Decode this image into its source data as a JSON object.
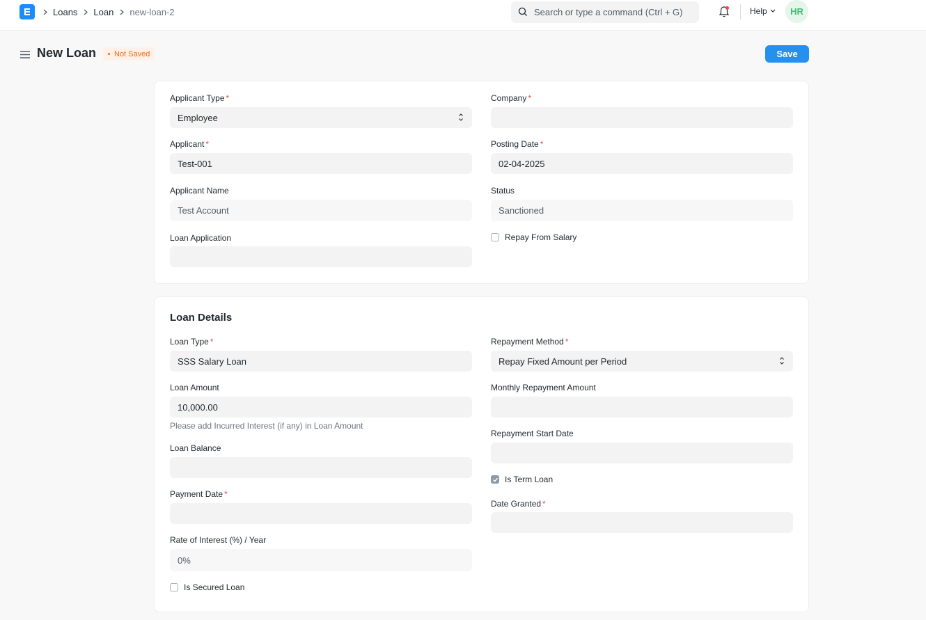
{
  "breadcrumb": [
    "Loans",
    "Loan",
    "new-loan-2"
  ],
  "search": {
    "placeholder": "Search or type a command (Ctrl + G)"
  },
  "navbar": {
    "help_label": "Help",
    "avatar_initials": "HR"
  },
  "page": {
    "title": "New Loan",
    "status_badge": "Not Saved",
    "save_label": "Save"
  },
  "section1": {
    "applicant_type": {
      "label": "Applicant Type",
      "value": "Employee"
    },
    "company": {
      "label": "Company",
      "value": ""
    },
    "applicant": {
      "label": "Applicant",
      "value": "Test-001"
    },
    "posting_date": {
      "label": "Posting Date",
      "value": "02-04-2025"
    },
    "applicant_name": {
      "label": "Applicant Name",
      "value": "Test Account"
    },
    "status": {
      "label": "Status",
      "value": "Sanctioned"
    },
    "loan_application": {
      "label": "Loan Application",
      "value": ""
    },
    "repay_from_salary": {
      "label": "Repay From Salary",
      "checked": false
    }
  },
  "section2": {
    "title": "Loan Details",
    "loan_type": {
      "label": "Loan Type",
      "value": "SSS Salary Loan"
    },
    "repayment_method": {
      "label": "Repayment Method",
      "value": "Repay Fixed Amount per Period"
    },
    "loan_amount": {
      "label": "Loan Amount",
      "value": "10,000.00",
      "help": "Please add Incurred Interest (if any) in Loan Amount"
    },
    "monthly_repayment_amount": {
      "label": "Monthly Repayment Amount",
      "value": ""
    },
    "repayment_start_date": {
      "label": "Repayment Start Date",
      "value": ""
    },
    "loan_balance": {
      "label": "Loan Balance",
      "value": ""
    },
    "is_term_loan": {
      "label": "Is Term Loan",
      "checked": true
    },
    "payment_date": {
      "label": "Payment Date",
      "value": ""
    },
    "date_granted": {
      "label": "Date Granted",
      "value": ""
    },
    "rate_of_interest": {
      "label": "Rate of Interest (%) / Year",
      "value": "0%"
    },
    "is_secured_loan": {
      "label": "Is Secured Loan",
      "checked": false
    }
  },
  "colors": {
    "primary": "#2490ef",
    "required": "#e24c4c",
    "badge_text": "#e86c13",
    "avatar_text": "#48bb74"
  }
}
